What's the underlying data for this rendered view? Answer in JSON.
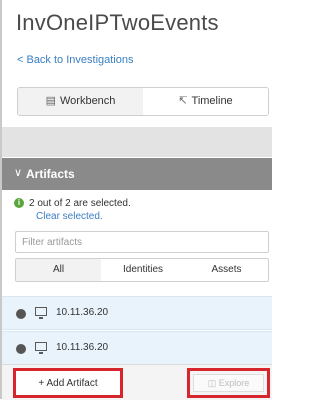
{
  "header": {
    "title": "InvOneIPTwoEvents",
    "back_link": "< Back to Investigations"
  },
  "view_tabs": [
    {
      "label": "Workbench",
      "icon": "workbench-icon",
      "active": true
    },
    {
      "label": "Timeline",
      "icon": "timeline-icon",
      "active": false
    }
  ],
  "artifacts": {
    "section_label": "Artifacts",
    "selection_text": "2 out of 2 are selected.",
    "clear_label": "Clear selected.",
    "filter_placeholder": "Filter artifacts",
    "filter_tabs": [
      "All",
      "Identities",
      "Assets"
    ],
    "items": [
      {
        "ip": "10.11.36.20",
        "icon": "monitor-icon",
        "selected": true
      },
      {
        "ip": "10.11.36.20",
        "icon": "monitor-icon",
        "selected": true
      }
    ]
  },
  "actions": {
    "add_label": "+ Add Artifact",
    "explore_label": "Explore",
    "highlight_color": "#d6252c"
  },
  "colors": {
    "link": "#3b7fc1",
    "section_bar": "#8a8a8a",
    "row_selected": "#e9f3fb",
    "info": "#58a63a"
  }
}
